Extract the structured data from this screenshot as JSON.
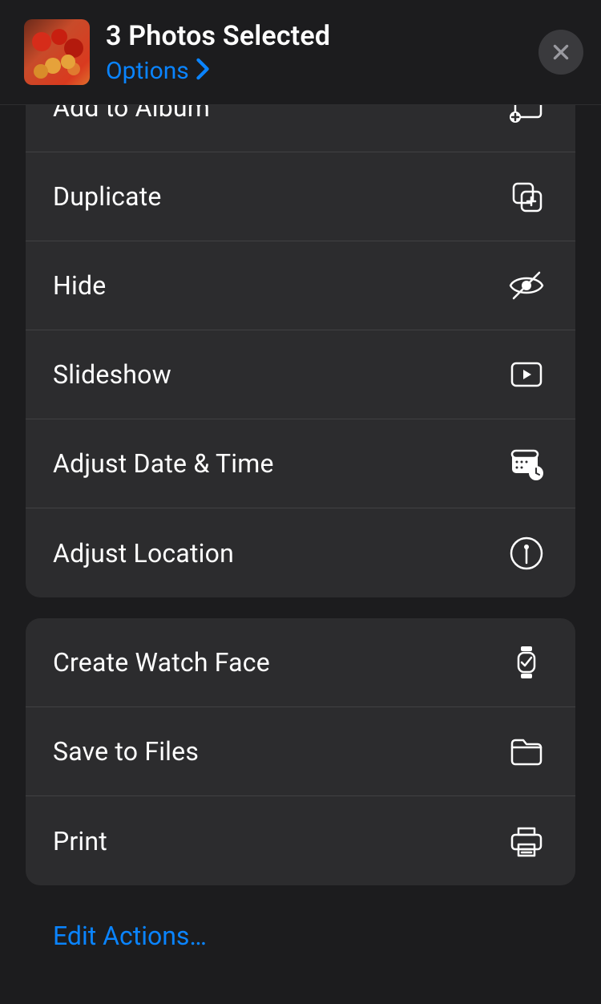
{
  "header": {
    "title": "3 Photos Selected",
    "options_label": "Options"
  },
  "groups": [
    {
      "rows": [
        {
          "label": "Add to Album",
          "icon": "add-album"
        },
        {
          "label": "Duplicate",
          "icon": "duplicate"
        },
        {
          "label": "Hide",
          "icon": "hide"
        },
        {
          "label": "Slideshow",
          "icon": "slideshow"
        },
        {
          "label": "Adjust Date & Time",
          "icon": "datetime"
        },
        {
          "label": "Adjust Location",
          "icon": "location"
        }
      ]
    },
    {
      "rows": [
        {
          "label": "Create Watch Face",
          "icon": "watch"
        },
        {
          "label": "Save to Files",
          "icon": "folder"
        },
        {
          "label": "Print",
          "icon": "print"
        }
      ]
    }
  ],
  "footer": {
    "edit_actions_label": "Edit Actions…"
  }
}
